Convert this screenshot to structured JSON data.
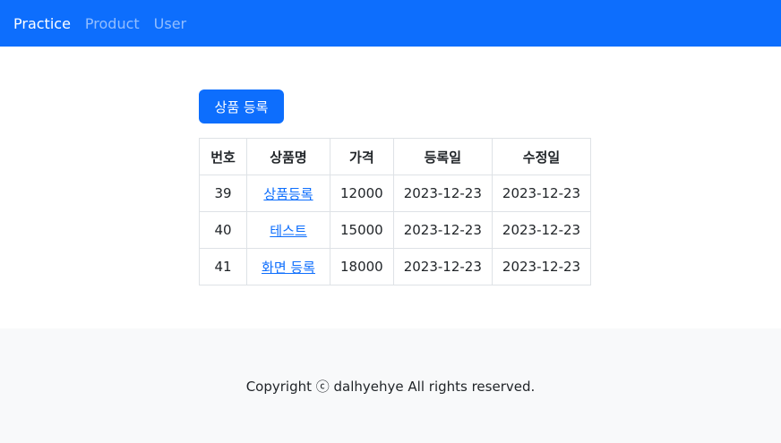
{
  "navbar": {
    "brand": "Practice",
    "links": [
      "Product",
      "User"
    ]
  },
  "main": {
    "register_button": "상품 등록",
    "table": {
      "headers": [
        "번호",
        "상품명",
        "가격",
        "등록일",
        "수정일"
      ],
      "rows": [
        {
          "id": "39",
          "name": "상품등록",
          "price": "12000",
          "created": "2023-12-23",
          "updated": "2023-12-23"
        },
        {
          "id": "40",
          "name": "테스트",
          "price": "15000",
          "created": "2023-12-23",
          "updated": "2023-12-23"
        },
        {
          "id": "41",
          "name": "화면 등록",
          "price": "18000",
          "created": "2023-12-23",
          "updated": "2023-12-23"
        }
      ]
    }
  },
  "footer": {
    "text": "Copyright ⓒ dalhyehye All rights reserved."
  },
  "colors": {
    "primary": "#0d6efd",
    "footer_bg": "#f8f9fa",
    "border": "#dee2e6"
  }
}
